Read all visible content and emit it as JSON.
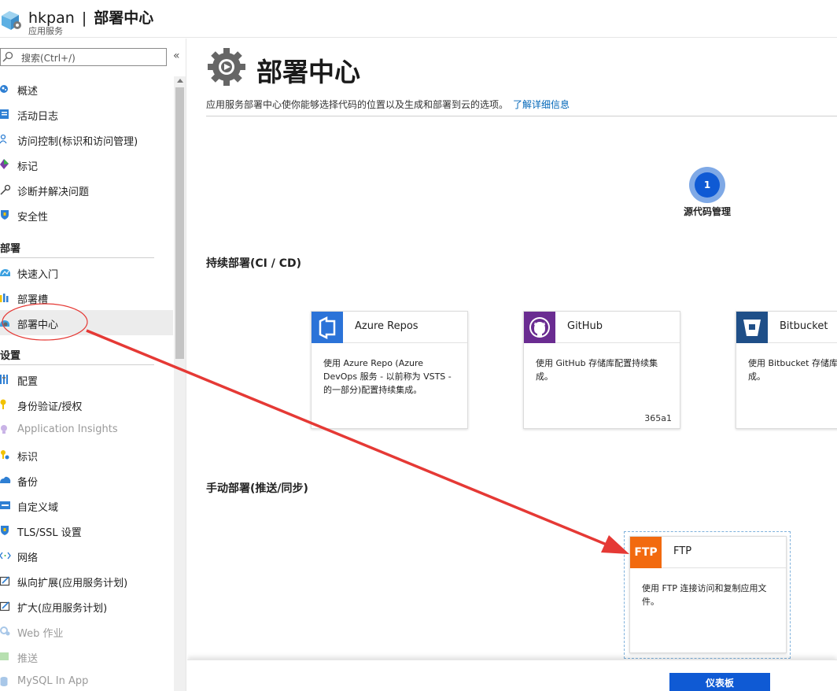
{
  "header": {
    "app_name": "hkpan",
    "separator": "|",
    "page_name": "部署中心",
    "subtitle": "应用服务",
    "icon": "app-service-icon"
  },
  "sidebar": {
    "search_placeholder": "搜索(Ctrl+/)",
    "collapse_label": "«",
    "top_items": [
      {
        "label": "概述",
        "icon": "overview-icon"
      },
      {
        "label": "活动日志",
        "icon": "activity-log-icon"
      },
      {
        "label": "访问控制(标识和访问管理)",
        "icon": "access-control-icon"
      },
      {
        "label": "标记",
        "icon": "tag-icon"
      },
      {
        "label": "诊断并解决问题",
        "icon": "wrench-icon"
      },
      {
        "label": "安全性",
        "icon": "security-shield-icon"
      }
    ],
    "section_deploy": "部署",
    "deploy_items": [
      {
        "label": "快速入门",
        "icon": "quickstart-icon"
      },
      {
        "label": "部署槽",
        "icon": "deployment-slots-icon"
      },
      {
        "label": "部署中心",
        "icon": "deployment-center-icon",
        "selected": true
      }
    ],
    "section_settings": "设置",
    "settings_items": [
      {
        "label": "配置",
        "icon": "configuration-icon"
      },
      {
        "label": "身份验证/授权",
        "icon": "key-icon"
      },
      {
        "label": "Application Insights",
        "icon": "lightbulb-icon",
        "dim": true
      },
      {
        "label": "标识",
        "icon": "identity-icon"
      },
      {
        "label": "备份",
        "icon": "backup-cloud-icon"
      },
      {
        "label": "自定义域",
        "icon": "custom-domain-icon"
      },
      {
        "label": "TLS/SSL 设置",
        "icon": "ssl-shield-icon"
      },
      {
        "label": "网络",
        "icon": "networking-icon"
      },
      {
        "label": "纵向扩展(应用服务计划)",
        "icon": "scale-up-icon"
      },
      {
        "label": "扩大(应用服务计划)",
        "icon": "scale-out-icon"
      },
      {
        "label": "Web 作业",
        "icon": "webjobs-icon",
        "dim": true
      },
      {
        "label": "推送",
        "icon": "push-icon",
        "dim": true
      },
      {
        "label": "MySQL In App",
        "icon": "mysql-icon",
        "dim": true
      }
    ]
  },
  "main": {
    "title": "部署中心",
    "description": "应用服务部署中心使你能够选择代码的位置以及生成和部署到云的选项。",
    "learn_more": "了解详细信息",
    "step": {
      "number": "1",
      "label": "源代码管理"
    },
    "ci_heading": "持续部署(CI / CD)",
    "manual_heading": "手动部署(推送/同步)",
    "cards": [
      {
        "name": "Azure Repos",
        "desc": "使用 Azure Repo (Azure DevOps 服务 - 以前称为 VSTS - 的一部分)配置持续集成。",
        "note": "",
        "logo_color": "#2b73d8"
      },
      {
        "name": "GitHub",
        "desc": "使用 GitHub 存储库配置持续集成。",
        "note": "365a1",
        "logo_color": "#6a2c91"
      },
      {
        "name": "Bitbucket",
        "desc": "使用 Bitbucket 存储库配置持续集成。",
        "note": "",
        "logo_color": "#1f4f88"
      }
    ],
    "ftp": {
      "logo_text": "FTP",
      "name": "FTP",
      "desc": "使用 FTP 连接访问和复制应用文件。",
      "logo_color": "#f26a0f"
    },
    "dashboard_button": "仪表板"
  },
  "annotation": {
    "color": "#e53935"
  }
}
